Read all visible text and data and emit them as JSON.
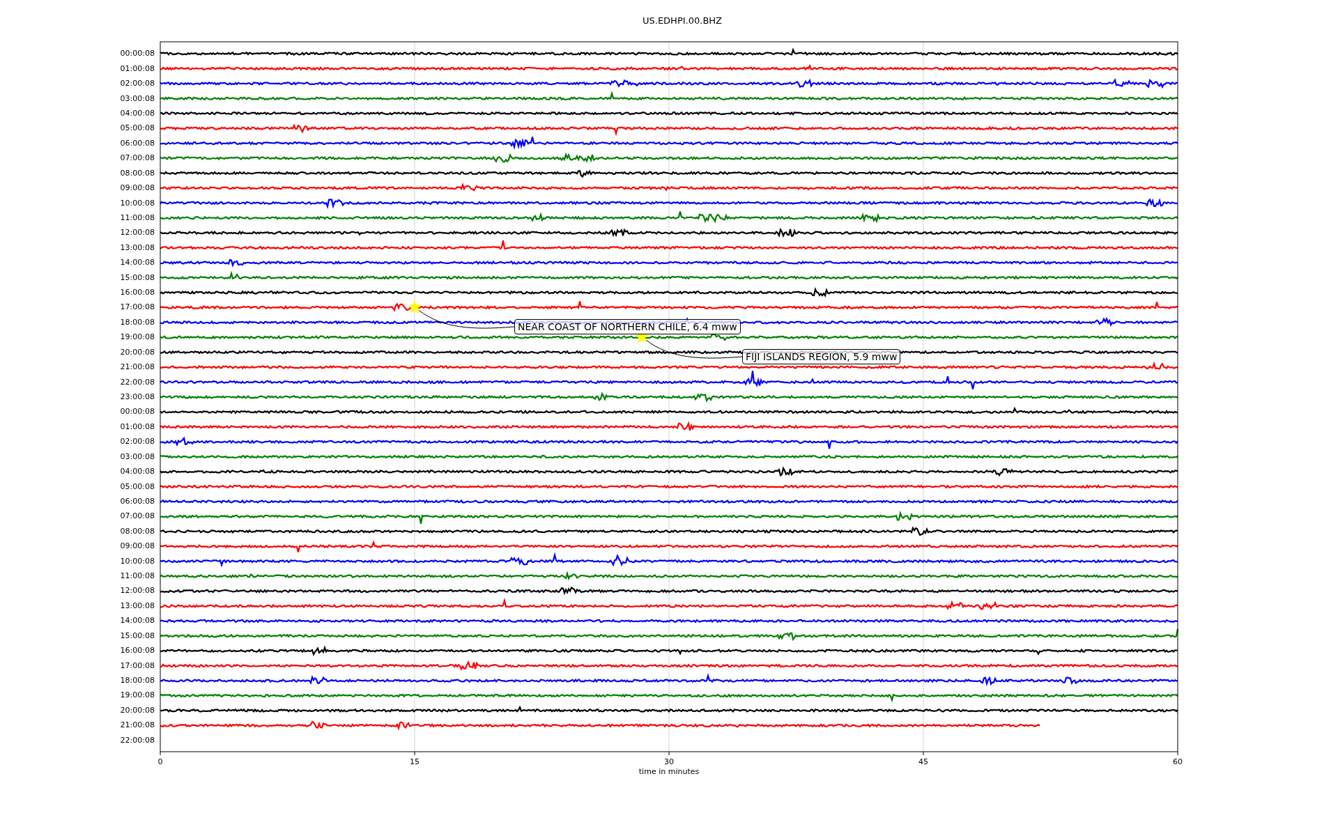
{
  "figure": {
    "title": "US.EDHPI.00.BHZ",
    "xlabel": "time in minutes",
    "xticks": [
      "0",
      "15",
      "30",
      "45",
      "60"
    ],
    "rows": [
      {
        "label": "00:00:08",
        "color": "#000000",
        "level": 1
      },
      {
        "label": "01:00:08",
        "color": "#ff0000",
        "level": 1
      },
      {
        "label": "02:00:08",
        "color": "#0000ff",
        "level": 1
      },
      {
        "label": "03:00:08",
        "color": "#008000",
        "level": 1
      },
      {
        "label": "04:00:08",
        "color": "#000000",
        "level": 1
      },
      {
        "label": "05:00:08",
        "color": "#ff0000",
        "level": 1
      },
      {
        "label": "06:00:08",
        "color": "#0000ff",
        "level": 1
      },
      {
        "label": "07:00:08",
        "color": "#008000",
        "level": 1
      },
      {
        "label": "08:00:08",
        "color": "#000000",
        "level": 1
      },
      {
        "label": "09:00:08",
        "color": "#ff0000",
        "level": 1
      },
      {
        "label": "10:00:08",
        "color": "#0000ff",
        "level": 1
      },
      {
        "label": "11:00:08",
        "color": "#008000",
        "level": 1
      },
      {
        "label": "12:00:08",
        "color": "#000000",
        "level": 1
      },
      {
        "label": "13:00:08",
        "color": "#ff0000",
        "level": 1
      },
      {
        "label": "14:00:08",
        "color": "#0000ff",
        "level": 1
      },
      {
        "label": "15:00:08",
        "color": "#008000",
        "level": 1
      },
      {
        "label": "16:00:08",
        "color": "#000000",
        "level": 1
      },
      {
        "label": "17:00:08",
        "color": "#ff0000",
        "level": 1
      },
      {
        "label": "18:00:08",
        "color": "#0000ff",
        "level": 1
      },
      {
        "label": "19:00:08",
        "color": "#008000",
        "level": 1
      },
      {
        "label": "20:00:08",
        "color": "#000000",
        "level": 1
      },
      {
        "label": "21:00:08",
        "color": "#ff0000",
        "level": 1
      },
      {
        "label": "22:00:08",
        "color": "#0000ff",
        "level": 1
      },
      {
        "label": "23:00:08",
        "color": "#008000",
        "level": 1
      },
      {
        "label": "00:00:08",
        "color": "#000000",
        "level": 1
      },
      {
        "label": "01:00:08",
        "color": "#ff0000",
        "level": 1
      },
      {
        "label": "02:00:08",
        "color": "#0000ff",
        "level": 1
      },
      {
        "label": "03:00:08",
        "color": "#008000",
        "level": 1
      },
      {
        "label": "04:00:08",
        "color": "#000000",
        "level": 1
      },
      {
        "label": "05:00:08",
        "color": "#ff0000",
        "level": 1
      },
      {
        "label": "06:00:08",
        "color": "#0000ff",
        "level": 1
      },
      {
        "label": "07:00:08",
        "color": "#008000",
        "level": 1
      },
      {
        "label": "08:00:08",
        "color": "#000000",
        "level": 1
      },
      {
        "label": "09:00:08",
        "color": "#ff0000",
        "level": 1
      },
      {
        "label": "10:00:08",
        "color": "#0000ff",
        "level": 1
      },
      {
        "label": "11:00:08",
        "color": "#008000",
        "level": 1
      },
      {
        "label": "12:00:08",
        "color": "#000000",
        "level": 1
      },
      {
        "label": "13:00:08",
        "color": "#ff0000",
        "level": 1
      },
      {
        "label": "14:00:08",
        "color": "#0000ff",
        "level": 1
      },
      {
        "label": "15:00:08",
        "color": "#008000",
        "level": 1
      },
      {
        "label": "16:00:08",
        "color": "#000000",
        "level": 1
      },
      {
        "label": "17:00:08",
        "color": "#ff0000",
        "level": 1
      },
      {
        "label": "18:00:08",
        "color": "#0000ff",
        "level": 1
      },
      {
        "label": "19:00:08",
        "color": "#008000",
        "level": 1
      },
      {
        "label": "20:00:08",
        "color": "#000000",
        "level": 1
      },
      {
        "label": "21:00:08",
        "color": "#ff0000",
        "level": 0.865
      },
      {
        "label": "22:00:08"
      }
    ],
    "events": [
      {
        "label": "NEAR COAST OF NORTHERN CHILE, 6.4 mww"
      },
      {
        "label": "FIJI ISLANDS REGION, 5.9 mww"
      }
    ]
  }
}
